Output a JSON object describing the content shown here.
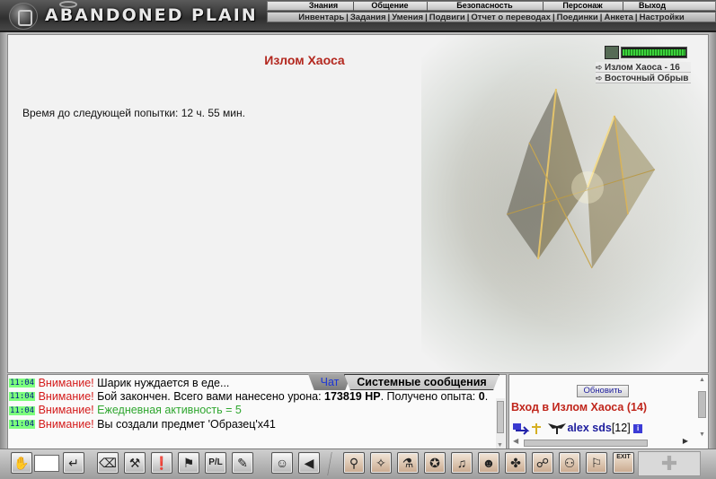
{
  "app": {
    "logo": "ABANDONED PLAIN"
  },
  "topnav": [
    "Знания",
    "Общение",
    "Безопасность",
    "Персонаж",
    "Выход"
  ],
  "subnav": [
    "Инвентарь",
    "Задания",
    "Умения",
    "Подвиги",
    "Отчет о переводах",
    "Поединки",
    "Анкета",
    "Настройки"
  ],
  "location": {
    "title": "Излом Хаоса",
    "timer": "Время до следующей попытки: 12 ч. 55 мин.",
    "hp_fill": 0.97,
    "exits": [
      "Излом Хаоса - 16",
      "Восточный Обрыв"
    ]
  },
  "chat": {
    "tabs": {
      "chat": "Чат",
      "system": "Системные сообщения"
    },
    "lines": [
      {
        "time": "11:04",
        "prefix": "Внимание!",
        "text": " Шарик нуждается в еде..."
      },
      {
        "time": "11:04",
        "prefix": "Внимание!",
        "text": " Бой закончен. Всего вами нанесено урона: ",
        "bold": "173819 HP",
        "text2": ". Получено опыта: ",
        "bold2": "0",
        "text3": "."
      },
      {
        "time": "11:04",
        "prefix": "Внимание!",
        "green": " Ежедневная активность = 5"
      },
      {
        "time": "11:04",
        "prefix": "Внимание!",
        "text": " Вы создали предмет 'Образец'x41"
      }
    ]
  },
  "online": {
    "refresh": "Обновить",
    "title": "Вход в Излом Хаоса (14)",
    "player": {
      "nick": "alex sds",
      "level": "[12]",
      "info": "i"
    }
  },
  "toolbar": {
    "icons": [
      "hand-icon",
      "enter-icon",
      "eraser-icon",
      "anvil-icon",
      "warning-icon",
      "runner-icon",
      "pl-icon",
      "tools-icon",
      "smile-icon",
      "speaker-icon",
      "bag-icon",
      "compass-icon",
      "flask-icon",
      "treasure-icon",
      "scroll-icon",
      "mask-icon",
      "creature-icon",
      "group-icon",
      "party-icon",
      "flag-icon",
      "exit-icon"
    ],
    "pl_label": "P/L",
    "exit_label": "EXIT"
  }
}
